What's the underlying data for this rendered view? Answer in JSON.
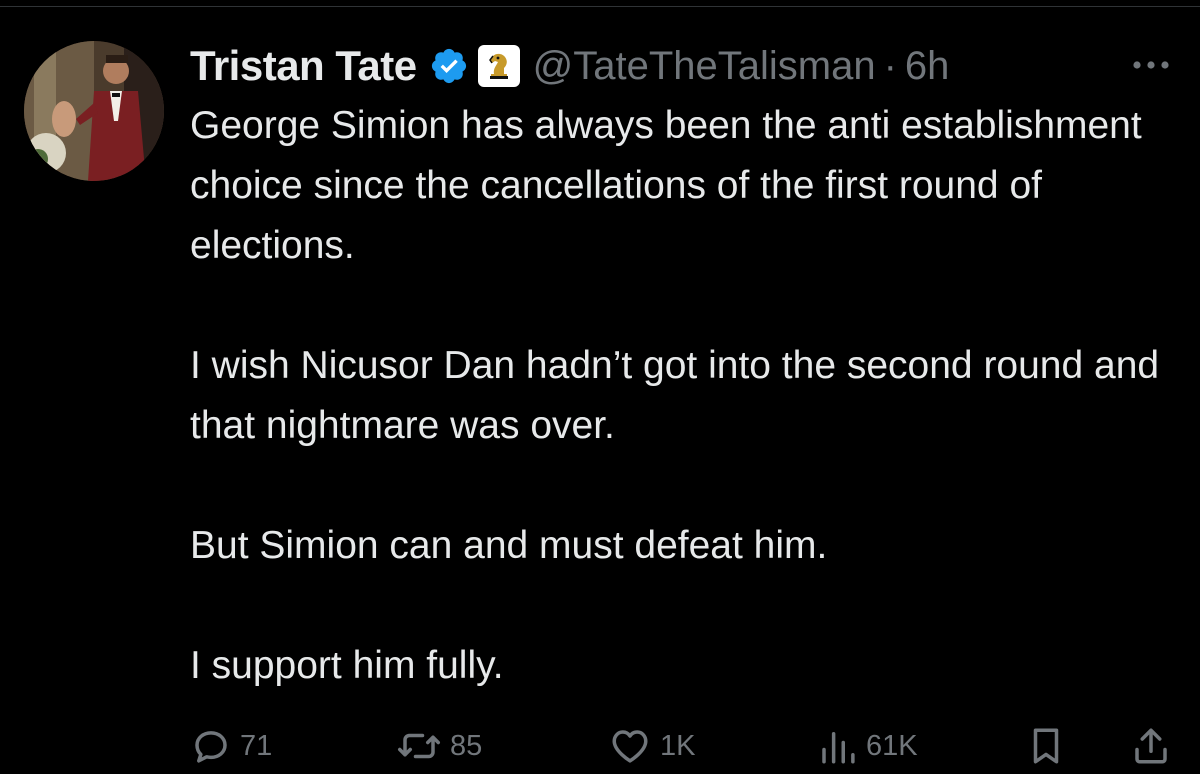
{
  "tweet": {
    "author": {
      "display_name": "Tristan Tate",
      "handle": "@TateTheTalisman",
      "verified": true,
      "separator": "·",
      "timestamp": "6h"
    },
    "body": [
      "George Simion has always been the anti establishment choice since the cancellations of the first round of elections.",
      "I wish Nicusor Dan hadn’t got into the second round and that nightmare was over.",
      "But Simion can and must defeat him.",
      "I support him fully."
    ],
    "actions": {
      "reply_count": "71",
      "repost_count": "85",
      "like_count": "1K",
      "view_count": "61K"
    }
  },
  "icons": {
    "verified": "verified-badge-icon",
    "affiliate": "chess-knight-affiliate-icon",
    "more": "more-options-icon",
    "reply": "reply-icon",
    "repost": "repost-icon",
    "like": "heart-icon",
    "views": "views-chart-icon",
    "bookmark": "bookmark-icon",
    "share": "share-icon"
  },
  "colors": {
    "background": "#000000",
    "primary_text": "#e7e9ea",
    "secondary_text": "#71767b",
    "verified_blue": "#1d9bf0",
    "affiliate_gold": "#c79a2b"
  }
}
